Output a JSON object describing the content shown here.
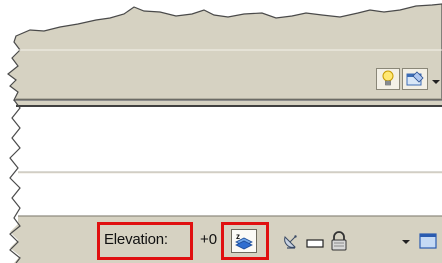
{
  "status_bar": {
    "elevation_label": "Elevation:",
    "elevation_value": "+0"
  },
  "icons": {
    "tray": [
      "lightbulb-icon",
      "clean-screen-icon",
      "dropdown-arrow-icon"
    ],
    "status": [
      "elevation-z-icon",
      "satellite-dish-icon",
      "rectangle-toggle-icon",
      "lock-icon",
      "dropdown-arrow-icon",
      "window-icon"
    ]
  },
  "colors": {
    "highlight": "#e01010",
    "toolbar_bg": "#d6d2c2",
    "window_border": "#8f8c80"
  }
}
